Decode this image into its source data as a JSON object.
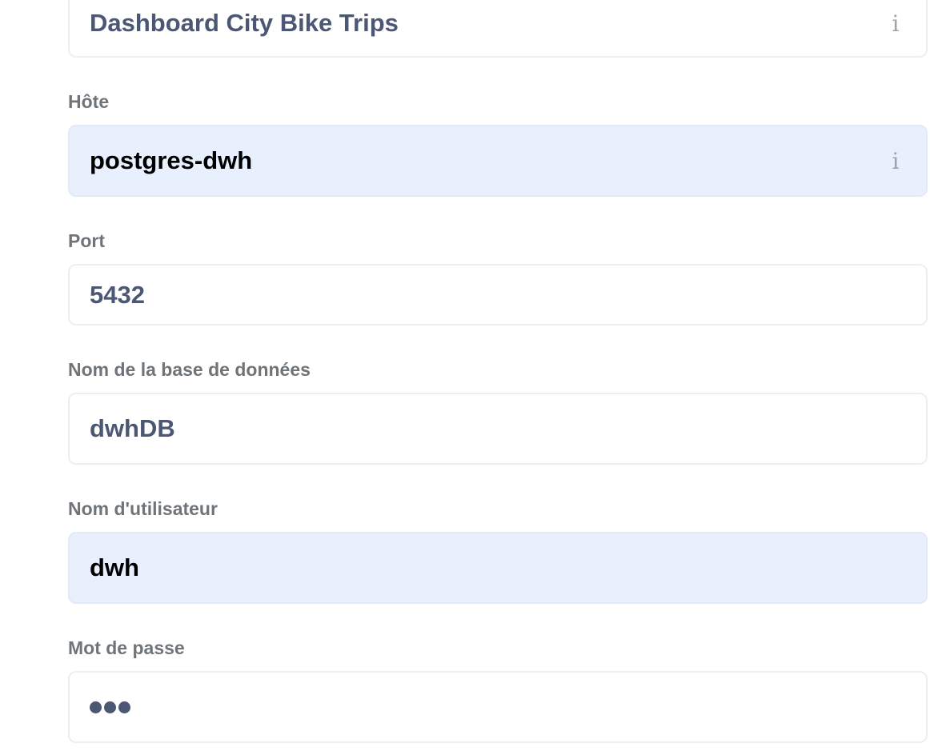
{
  "fields": [
    {
      "id": "display_name",
      "label": "",
      "value": "Dashboard City Bike Trips",
      "has_info": true,
      "autofill": false
    },
    {
      "id": "host",
      "label": "Hôte",
      "value": "postgres-dwh",
      "has_info": true,
      "autofill": true
    },
    {
      "id": "port",
      "label": "Port",
      "value": "5432",
      "has_info": false,
      "autofill": false
    },
    {
      "id": "dbname",
      "label": "Nom de la base de données",
      "value": "dwhDB",
      "has_info": false,
      "autofill": false
    },
    {
      "id": "user",
      "label": "Nom d'utilisateur",
      "value": "dwh",
      "has_info": false,
      "autofill": true
    },
    {
      "id": "password",
      "label": "Mot de passe",
      "value": "•••",
      "masked_length": 3,
      "has_info": false,
      "autofill": false
    }
  ],
  "icons": {
    "info": "info-icon"
  },
  "colors": {
    "label": "#6f7479",
    "value": "#4c5773",
    "autofill_bg": "#e8f0fe",
    "border": "#eceeef"
  }
}
